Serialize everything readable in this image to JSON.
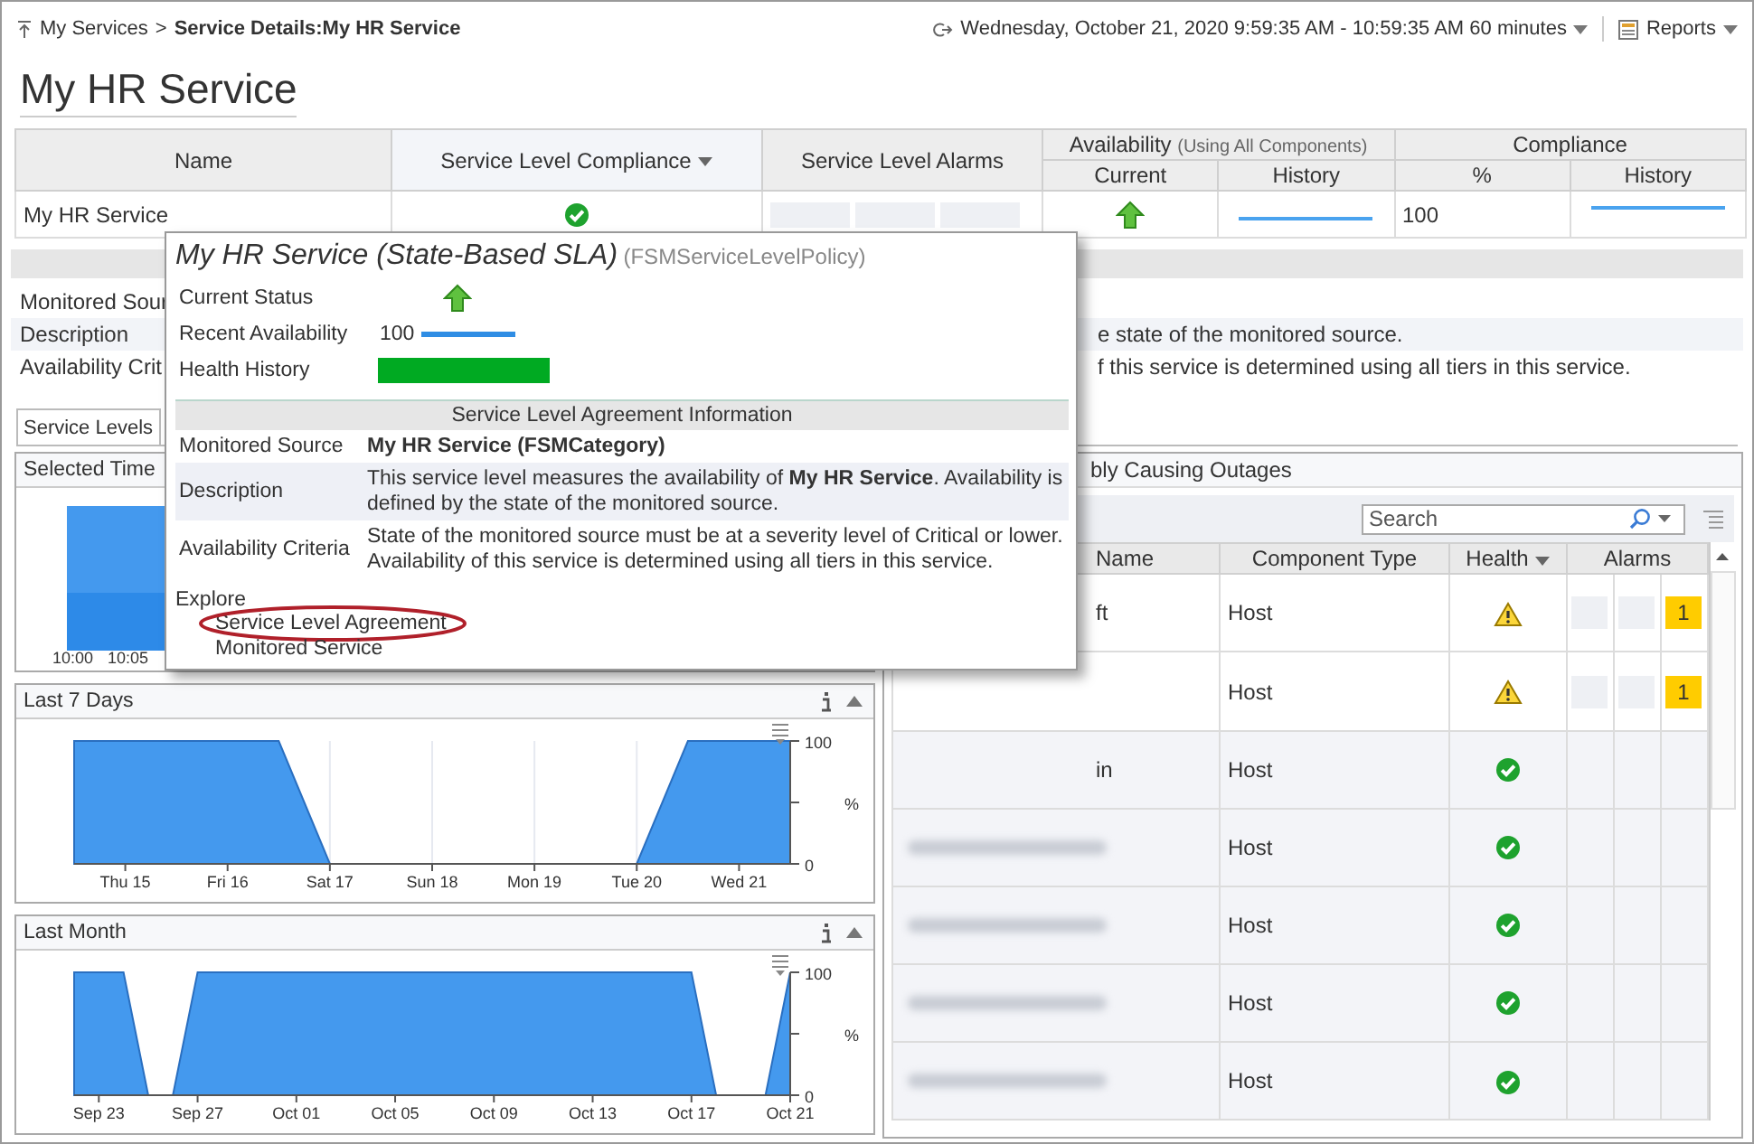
{
  "breadcrumb": {
    "parent": "My Services",
    "separator": ">",
    "current": "Service Details:My HR Service"
  },
  "time_range": {
    "label": "Wednesday, October 21, 2020 9:59:35 AM - 10:59:35 AM 60 minutes"
  },
  "reports_button": {
    "label": "Reports"
  },
  "title": "My HR Service",
  "summary_table": {
    "columns": [
      {
        "label": "Name",
        "sorted": false
      },
      {
        "label": "Service Level Compliance",
        "sorted": true
      },
      {
        "label": "Service Level Alarms",
        "sorted": false
      }
    ],
    "availability": {
      "label": "Availability",
      "note": "(Using All Components)",
      "sub": [
        "Current",
        "History"
      ]
    },
    "compliance": {
      "label": "Compliance",
      "sub": [
        "%",
        "History"
      ]
    },
    "rows": [
      {
        "name": "My HR Service",
        "compliant": true,
        "available": true,
        "compliance_pct": "100"
      }
    ]
  },
  "details": [
    {
      "label": "Monitored Sour"
    },
    {
      "label": "Description",
      "value": "e state of the monitored source."
    },
    {
      "label": "Availability Crit",
      "value": "f this service is determined using all tiers in this service."
    }
  ],
  "tabs": [
    {
      "label": "Service Levels",
      "selected": true
    }
  ],
  "selected_time": {
    "title": "Selected Time",
    "x_labels": [
      "10:00",
      "10:05"
    ]
  },
  "last_7_days": {
    "title": "Last 7 Days",
    "chart_data": {
      "type": "area",
      "ylabel": "%",
      "grid": true,
      "categories": [
        null,
        "Thu 15",
        null,
        "Fri 16",
        null,
        "Sat 17",
        null,
        "Sun 18",
        null,
        "Mon 19",
        null,
        "Tue 20",
        null,
        "Wed 21",
        null
      ],
      "values": [
        100,
        100,
        100,
        100,
        100,
        0,
        0,
        0,
        0,
        0,
        0,
        0,
        100,
        100,
        100
      ],
      "ylim": [
        0,
        100
      ],
      "yticks": [
        0,
        100
      ]
    }
  },
  "last_month": {
    "title": "Last Month",
    "chart_data": {
      "type": "area",
      "ylabel": "%",
      "categories": [
        null,
        "Sep 23",
        null,
        null,
        null,
        "Sep 27",
        null,
        null,
        null,
        "Oct 01",
        null,
        null,
        null,
        "Oct 05",
        null,
        null,
        null,
        "Oct 09",
        null,
        null,
        null,
        "Oct 13",
        null,
        null,
        null,
        "Oct 17",
        null,
        null,
        null,
        "Oct 21"
      ],
      "values": [
        100,
        100,
        100,
        0,
        0,
        100,
        100,
        100,
        100,
        100,
        100,
        100,
        100,
        100,
        100,
        100,
        100,
        100,
        100,
        100,
        100,
        100,
        100,
        100,
        100,
        100,
        0,
        0,
        0,
        100
      ],
      "ylim": [
        0,
        100
      ],
      "yticks": [
        0,
        100
      ]
    }
  },
  "components_panel": {
    "title": "bly Causing Outages",
    "search": {
      "placeholder": "Search"
    },
    "columns": [
      "Name",
      "Component Type",
      "Health",
      "Alarms"
    ],
    "rows": [
      {
        "name": "ft",
        "type": "Host",
        "warning": true,
        "critical_alarms": "1",
        "redacted": false
      },
      {
        "type": "Host",
        "warning": true,
        "critical_alarms": "1",
        "redacted": false
      },
      {
        "name": "in",
        "type": "Host",
        "warning": false,
        "redacted": false
      },
      {
        "type": "Host",
        "warning": false,
        "redacted": true
      },
      {
        "type": "Host",
        "warning": false,
        "redacted": true
      },
      {
        "type": "Host",
        "warning": false,
        "redacted": true
      },
      {
        "type": "Host",
        "warning": false,
        "redacted": true
      }
    ]
  },
  "popup": {
    "title": "My HR Service (State-Based SLA)",
    "type": "(FSMServiceLevelPolicy)",
    "status": [
      {
        "label": "Current Status",
        "kind": "arrow"
      },
      {
        "label": "Recent Availability",
        "kind": "sparkline",
        "value": "100"
      },
      {
        "label": "Health History",
        "kind": "bar"
      }
    ],
    "section": "Service Level Agreement Information",
    "info": [
      {
        "label": "Monitored Source",
        "value": "**My HR Service (FSMCategory)**"
      },
      {
        "label": "Description",
        "value": "This service level measures the availability of **My HR Service**. Availability is defined by the state of the monitored source."
      },
      {
        "label": "Availability Criteria",
        "value": "State of the monitored source must be at a severity level of Critical or lower. Availability of this service is determined using all tiers in this service."
      }
    ],
    "explore": {
      "label": "Explore",
      "links": [
        {
          "label": "Service Level Agreement",
          "highlighted": true
        },
        {
          "label": "Monitored Service",
          "highlighted": false
        }
      ]
    }
  }
}
